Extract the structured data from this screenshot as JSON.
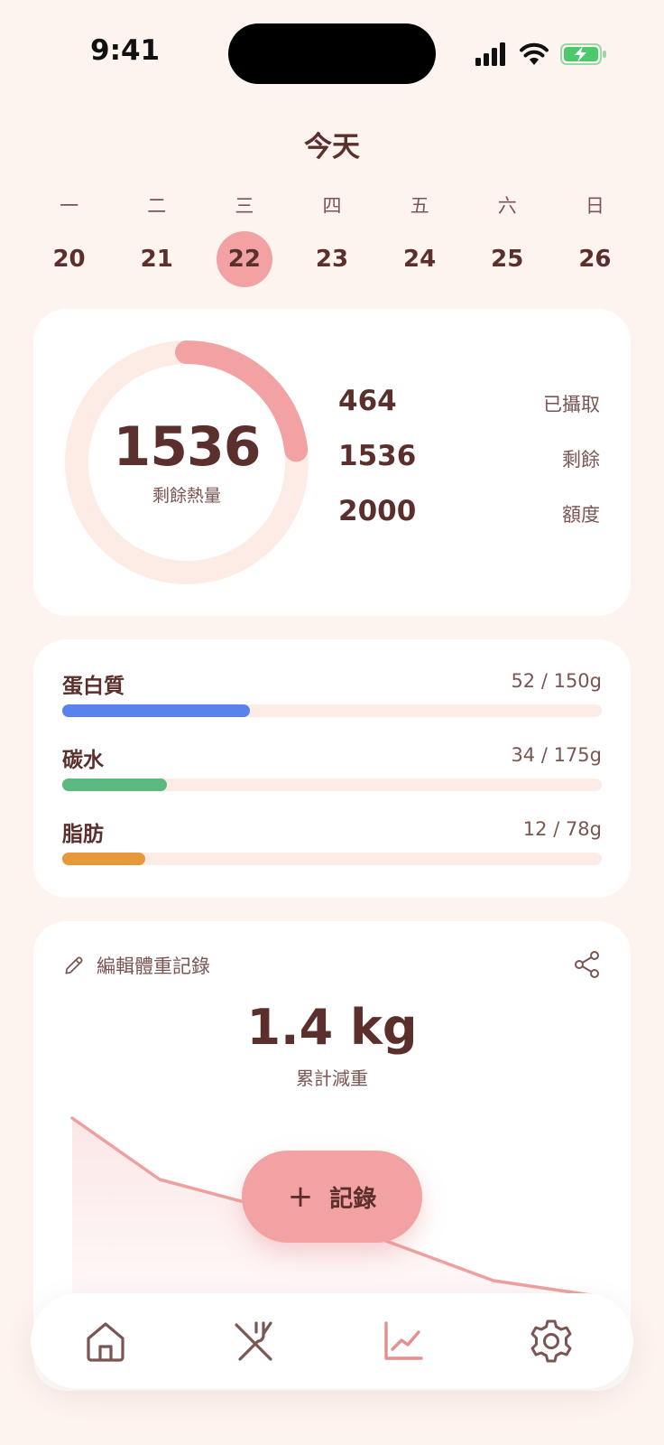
{
  "status": {
    "time": "9:41"
  },
  "header": {
    "title": "今天"
  },
  "week": [
    {
      "dayname": "一",
      "date": "20"
    },
    {
      "dayname": "二",
      "date": "21"
    },
    {
      "dayname": "三",
      "date": "22",
      "selected": true
    },
    {
      "dayname": "四",
      "date": "23"
    },
    {
      "dayname": "五",
      "date": "24"
    },
    {
      "dayname": "六",
      "date": "25"
    },
    {
      "dayname": "日",
      "date": "26"
    }
  ],
  "calories": {
    "remaining_value": "1536",
    "remaining_label": "剩餘熱量",
    "progress": 0.232,
    "stats": [
      {
        "value": "464",
        "label": "已攝取"
      },
      {
        "value": "1536",
        "label": "剩餘"
      },
      {
        "value": "2000",
        "label": "額度"
      }
    ]
  },
  "macros": [
    {
      "name": "蛋白質",
      "amount": "52 / 150g",
      "fraction": 0.347,
      "color": "#5a82ec"
    },
    {
      "name": "碳水",
      "amount": "34 / 175g",
      "fraction": 0.194,
      "color": "#5cb97e"
    },
    {
      "name": "脂肪",
      "amount": "12 / 78g",
      "fraction": 0.154,
      "color": "#e7983a"
    }
  ],
  "weight": {
    "edit_label": "編輯體重記錄",
    "total_value": "1.4 kg",
    "total_label": "累計減重"
  },
  "fab": {
    "label": "記錄"
  },
  "nav": [
    {
      "icon": "home-icon"
    },
    {
      "icon": "food-icon"
    },
    {
      "icon": "chart-icon",
      "active": true
    },
    {
      "icon": "settings-icon"
    }
  ],
  "colors": {
    "accent": "#f2a2a2",
    "text": "#5a2f2c",
    "muted": "#7a5552",
    "background": "#fdf3ef"
  }
}
